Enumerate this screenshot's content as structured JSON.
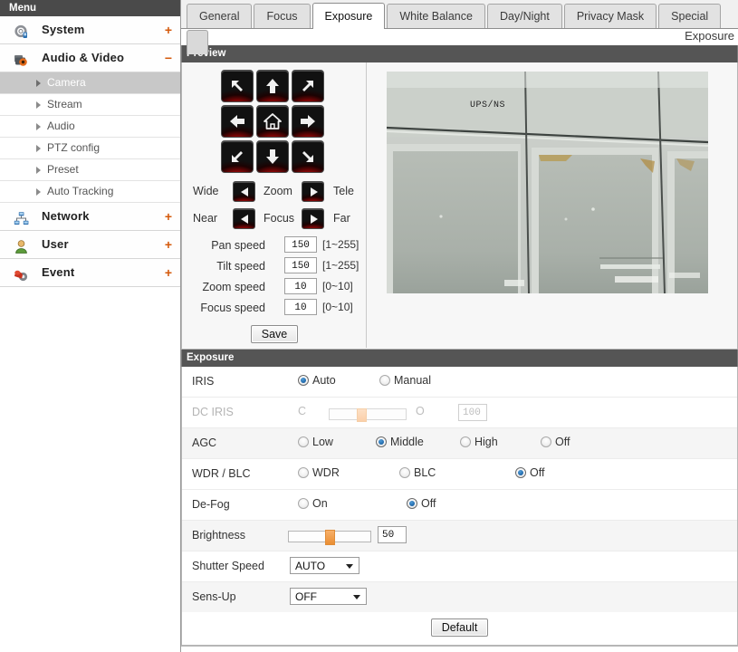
{
  "sidebar": {
    "header": "Menu",
    "top_items": [
      {
        "label": "System",
        "icon": "system-gear-icon",
        "toggle": "+"
      },
      {
        "label": "Audio & Video",
        "icon": "camera-icon",
        "toggle": "−"
      },
      {
        "label": "Network",
        "icon": "network-icon",
        "toggle": "+"
      },
      {
        "label": "User",
        "icon": "user-icon",
        "toggle": "+"
      },
      {
        "label": "Event",
        "icon": "event-bell-icon",
        "toggle": "+"
      }
    ],
    "sub_items": [
      {
        "label": "Camera",
        "active": true
      },
      {
        "label": "Stream",
        "active": false
      },
      {
        "label": "Audio",
        "active": false
      },
      {
        "label": "PTZ config",
        "active": false
      },
      {
        "label": "Preset",
        "active": false
      },
      {
        "label": "Auto Tracking",
        "active": false
      }
    ]
  },
  "tabs": [
    {
      "label": "General",
      "selected": false
    },
    {
      "label": "Focus",
      "selected": false
    },
    {
      "label": "Exposure",
      "selected": true
    },
    {
      "label": "White Balance",
      "selected": false
    },
    {
      "label": "Day/Night",
      "selected": false
    },
    {
      "label": "Privacy Mask",
      "selected": false
    },
    {
      "label": "Special",
      "selected": false
    }
  ],
  "breadcrumb": "Exposure",
  "preview": {
    "title": "Preview",
    "ptz": {
      "directions": [
        "arrow-up-left-icon",
        "arrow-up-icon",
        "arrow-up-right-icon",
        "arrow-left-icon",
        "home-icon",
        "arrow-right-icon",
        "arrow-down-left-icon",
        "arrow-down-icon",
        "arrow-down-right-icon"
      ],
      "zoom_row": {
        "left_label": "Wide",
        "center_label": "Zoom",
        "right_label": "Tele"
      },
      "focus_row": {
        "left_label": "Near",
        "center_label": "Focus",
        "right_label": "Far"
      },
      "speeds": [
        {
          "label": "Pan speed",
          "value": "150",
          "range": "[1~255]"
        },
        {
          "label": "Tilt speed",
          "value": "150",
          "range": "[1~255]"
        },
        {
          "label": "Zoom speed",
          "value": "10",
          "range": "[0~10]"
        },
        {
          "label": "Focus speed",
          "value": "10",
          "range": "[0~10]"
        }
      ],
      "save_label": "Save"
    },
    "video_osd": "UPS/NS"
  },
  "exposure": {
    "title": "Exposure",
    "iris": {
      "label": "IRIS",
      "options": [
        {
          "label": "Auto",
          "selected": true
        },
        {
          "label": "Manual",
          "selected": false
        }
      ]
    },
    "dc_iris": {
      "label": "DC IRIS",
      "min_label": "C",
      "max_label": "O",
      "value": "100",
      "slider_percent": 38,
      "disabled": true
    },
    "agc": {
      "label": "AGC",
      "options": [
        {
          "label": "Low",
          "selected": false
        },
        {
          "label": "Middle",
          "selected": true
        },
        {
          "label": "High",
          "selected": false
        },
        {
          "label": "Off",
          "selected": false
        }
      ]
    },
    "wdr_blc": {
      "label": "WDR / BLC",
      "options": [
        {
          "label": "WDR",
          "selected": false
        },
        {
          "label": "BLC",
          "selected": false
        },
        {
          "label": "Off",
          "selected": true
        }
      ]
    },
    "defog": {
      "label": "De-Fog",
      "options": [
        {
          "label": "On",
          "selected": false
        },
        {
          "label": "Off",
          "selected": true
        }
      ]
    },
    "brightness": {
      "label": "Brightness",
      "value": "50",
      "slider_percent": 50
    },
    "shutter_speed": {
      "label": "Shutter Speed",
      "value": "AUTO"
    },
    "sens_up": {
      "label": "Sens-Up",
      "value": "OFF"
    },
    "default_label": "Default"
  },
  "colors": {
    "accent_orange": "#d4590b",
    "section_bar": "#555555",
    "radio_blue": "#0a4f93",
    "slider_thumb": "#ea8e33"
  }
}
